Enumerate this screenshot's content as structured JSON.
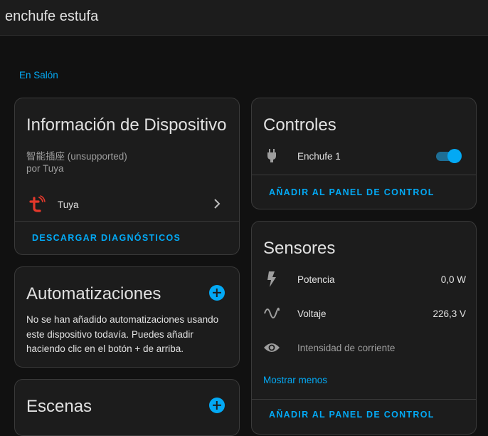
{
  "header": {
    "title": "enchufe estufa"
  },
  "area_link": "En Salón",
  "device_info": {
    "title": "Información de Dispositivo",
    "model": "智能插座 (unsupported)",
    "manufacturer": "por Tuya",
    "integration_label": "Tuya",
    "download_diagnostics": "DESCARGAR DIAGNÓSTICOS"
  },
  "automations": {
    "title": "Automatizaciones",
    "empty_text": "No se han añadido automatizaciones usando este dispositivo todavía. Puedes añadir haciendo clic en el botón + de arriba."
  },
  "scenes": {
    "title": "Escenas"
  },
  "controls": {
    "title": "Controles",
    "entity_label": "Enchufe 1",
    "entity_state": "on",
    "add_to_dashboard": "AÑADIR AL PANEL DE CONTROL"
  },
  "sensors": {
    "title": "Sensores",
    "items": [
      {
        "label": "Potencia",
        "value": "0,0 W",
        "icon": "flash-icon"
      },
      {
        "label": "Voltaje",
        "value": "226,3 V",
        "icon": "sine-wave-icon"
      },
      {
        "label": "Intensidad de corriente",
        "value": "",
        "icon": "eye-icon"
      }
    ],
    "show_less": "Mostrar menos",
    "add_to_dashboard": "AÑADIR AL PANEL DE CONTROL"
  },
  "colors": {
    "accent": "#03a9f4",
    "card": "#1c1c1c",
    "background": "#111111",
    "icon": "#9e9e9e"
  }
}
